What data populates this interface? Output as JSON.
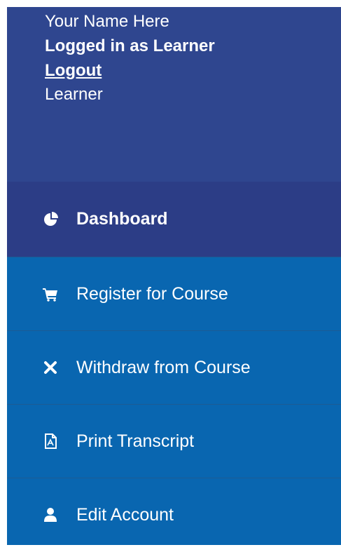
{
  "user": {
    "name": "Your Name Here",
    "login_status": "Logged in as Learner",
    "logout_link": "Logout",
    "role": "Learner"
  },
  "menu": {
    "items": [
      {
        "label": "Dashboard",
        "icon": "pie-chart-icon",
        "active": true
      },
      {
        "label": "Register for Course",
        "icon": "cart-icon",
        "active": false
      },
      {
        "label": "Withdraw from Course",
        "icon": "times-icon",
        "active": false
      },
      {
        "label": "Print Transcript",
        "icon": "pdf-file-icon",
        "active": false
      },
      {
        "label": "Edit Account",
        "icon": "user-icon",
        "active": false
      }
    ]
  },
  "colors": {
    "profile_bg": "#2f468f",
    "active_bg": "#2c3d86",
    "menu_bg": "#0966b0",
    "text": "#ffffff"
  }
}
